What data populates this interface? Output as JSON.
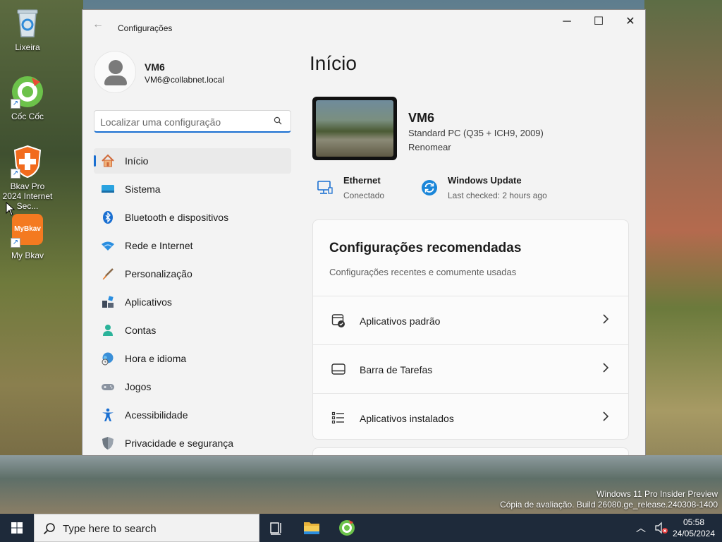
{
  "desktop": {
    "icons": [
      {
        "label": "Lixeira"
      },
      {
        "label": "Cốc Cốc"
      },
      {
        "label": "Bkav Pro 2024 Internet Sec..."
      },
      {
        "label": "My Bkav",
        "badge_text": "MyBkav"
      }
    ],
    "watermark": {
      "line1": "Windows 11 Pro Insider Preview",
      "line2": "Cópia de avaliação. Build 26080.ge_release.240308-1400"
    }
  },
  "window": {
    "title": "Configurações",
    "controls": {
      "minimize": "─",
      "maximize": "☐",
      "close": "✕"
    }
  },
  "profile": {
    "name": "VM6",
    "email": "VM6@collabnet.local"
  },
  "search": {
    "placeholder": "Localizar uma configuração"
  },
  "nav": {
    "items": [
      {
        "label": "Início",
        "icon": "home-icon",
        "active": true
      },
      {
        "label": "Sistema",
        "icon": "system-icon"
      },
      {
        "label": "Bluetooth e dispositivos",
        "icon": "bluetooth-icon"
      },
      {
        "label": "Rede e Internet",
        "icon": "wifi-icon"
      },
      {
        "label": "Personalização",
        "icon": "brush-icon"
      },
      {
        "label": "Aplicativos",
        "icon": "apps-icon"
      },
      {
        "label": "Contas",
        "icon": "account-icon"
      },
      {
        "label": "Hora e idioma",
        "icon": "globe-clock-icon"
      },
      {
        "label": "Jogos",
        "icon": "gamepad-icon"
      },
      {
        "label": "Acessibilidade",
        "icon": "accessibility-icon"
      },
      {
        "label": "Privacidade e segurança",
        "icon": "shield-icon"
      }
    ]
  },
  "main": {
    "title": "Início",
    "device": {
      "name": "VM6",
      "spec": "Standard PC (Q35 + ICH9, 2009)",
      "rename": "Renomear"
    },
    "status": [
      {
        "title": "Ethernet",
        "subtitle": "Conectado",
        "icon": "ethernet-icon"
      },
      {
        "title": "Windows Update",
        "subtitle": "Last checked: 2 hours ago",
        "icon": "windows-update-icon"
      }
    ],
    "recommended": {
      "title": "Configurações recomendadas",
      "subtitle": "Configurações recentes e comumente usadas",
      "items": [
        {
          "label": "Aplicativos padrão",
          "icon": "default-apps-icon"
        },
        {
          "label": "Barra de Tarefas",
          "icon": "taskbar-icon"
        },
        {
          "label": "Aplicativos instalados",
          "icon": "installed-apps-icon"
        }
      ]
    }
  },
  "taskbar": {
    "search_label": "Type here to search",
    "time": "05:58",
    "date": "24/05/2024"
  },
  "colors": {
    "accent": "#1a6fd1",
    "taskbar": "#1e2a3a"
  }
}
